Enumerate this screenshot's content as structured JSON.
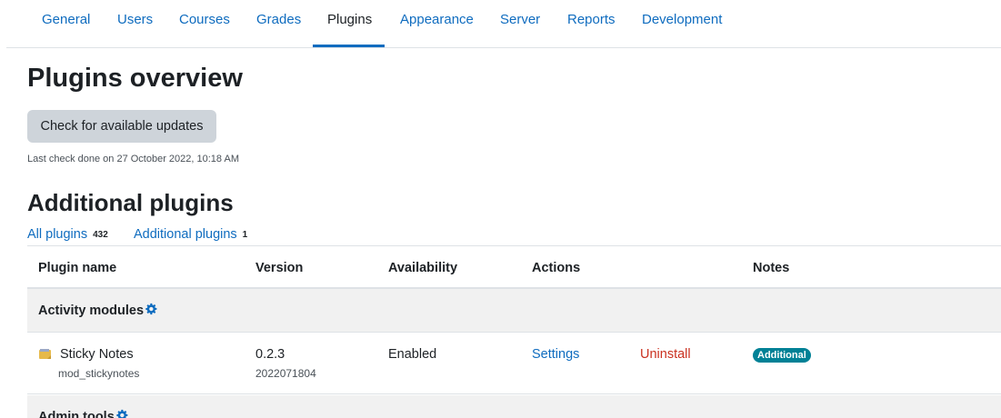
{
  "nav": {
    "tabs": [
      {
        "label": "General"
      },
      {
        "label": "Users"
      },
      {
        "label": "Courses"
      },
      {
        "label": "Grades"
      },
      {
        "label": "Plugins",
        "active": true
      },
      {
        "label": "Appearance"
      },
      {
        "label": "Server"
      },
      {
        "label": "Reports"
      },
      {
        "label": "Development"
      }
    ]
  },
  "page": {
    "title": "Plugins overview",
    "check_button": "Check for available updates",
    "last_check": "Last check done on 27 October 2022, 10:18 AM"
  },
  "section": {
    "title": "Additional plugins",
    "filters": [
      {
        "label": "All plugins",
        "count": "432"
      },
      {
        "label": "Additional plugins",
        "count": "1"
      }
    ]
  },
  "table": {
    "headers": [
      "Plugin name",
      "Version",
      "Availability",
      "Actions",
      "Notes"
    ],
    "groups": [
      {
        "label": "Activity modules",
        "plugins": [
          {
            "name": "Sticky Notes",
            "component": "mod_stickynotes",
            "version": "0.2.3",
            "build": "2022071804",
            "availability": "Enabled",
            "settings": "Settings",
            "uninstall": "Uninstall",
            "note": "Additional"
          }
        ]
      },
      {
        "label": "Admin tools",
        "plugins": []
      }
    ]
  },
  "colors": {
    "link": "#0f6cbf",
    "danger": "#ca3120",
    "badge": "#008196",
    "button_bg": "#ced4da",
    "group_bg": "#f1f1f1"
  },
  "icons": {
    "group_settings": "gear-icon",
    "plugin_icon": "sticky-note-icon"
  }
}
